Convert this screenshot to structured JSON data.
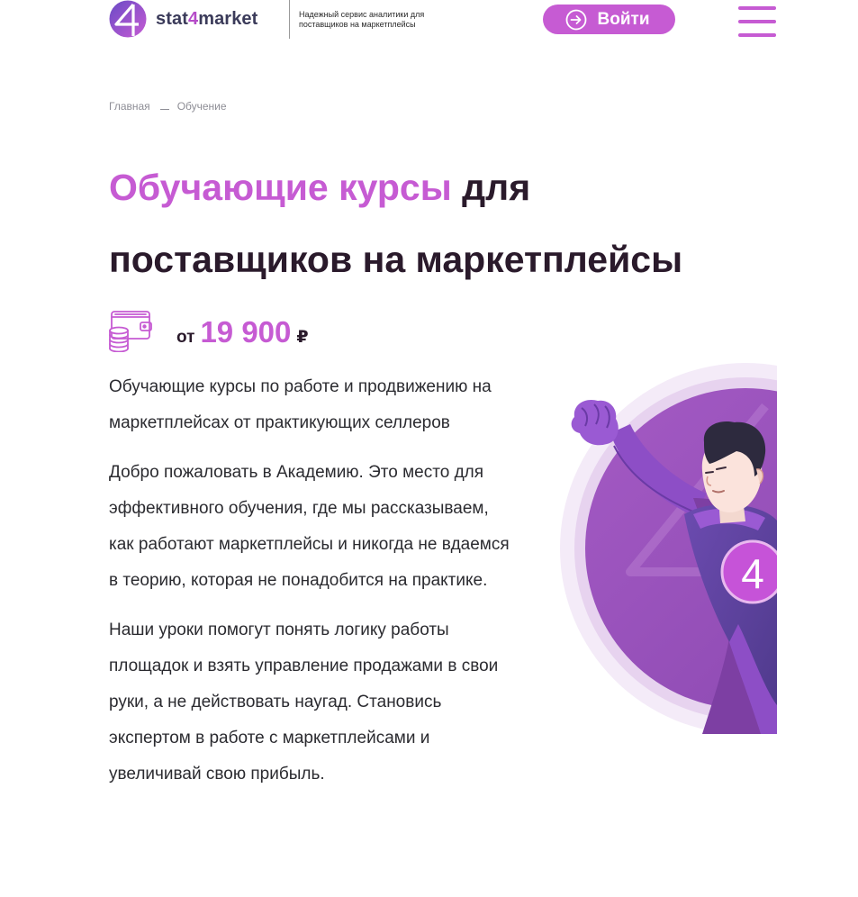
{
  "header": {
    "logo_text_prefix": "stat",
    "logo_text_digit": "4",
    "logo_text_suffix": "market",
    "tagline": "Надежный сервис аналитики для поставщиков на маркетплейсы",
    "login_label": "Войти",
    "login_icon": "login-arrow-icon",
    "menu_icon": "hamburger-menu-icon"
  },
  "breadcrumb": {
    "home": "Главная",
    "current": "Обучение"
  },
  "title": {
    "accent": "Обучающие курсы",
    "rest": " для поставщиков на маркетплейсы"
  },
  "price": {
    "icon": "wallet-coins-icon",
    "from": "от",
    "amount": "19 900",
    "currency": "₽"
  },
  "content": {
    "paragraphs": [
      "Обучающие курсы по работе и продвижению на маркетплейсах от практикующих селлеров",
      "Добро пожаловать в Академию. Это место для эффективного обучения, где мы рассказываем, как работают маркетплейсы и никогда не вдаемся в теорию, которая не понадобится на практике.",
      "Наши уроки помогут понять логику работы площадок и взять управление продажами в свои руки, а не действовать наугад. Становись экспертом в работе с маркетплейсами и увеличивай свою прибыль."
    ]
  },
  "hero": {
    "image": "superhero-illustration",
    "badge_digit": "4"
  },
  "colors": {
    "accent": "#c65bd3",
    "text_dark": "#2a1a2b",
    "text_body": "#2b2b30",
    "muted": "#8e8e96",
    "circle_purple": "#9a52b8"
  }
}
